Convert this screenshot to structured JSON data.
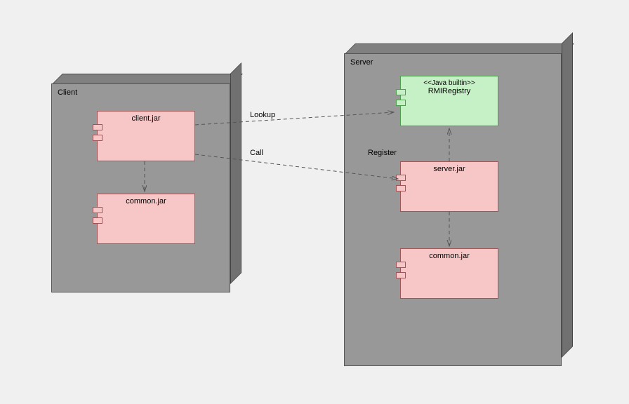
{
  "nodes": {
    "client": {
      "title": "Client"
    },
    "server": {
      "title": "Server"
    }
  },
  "components": {
    "client_jar": "client.jar",
    "client_common": "common.jar",
    "rmi_stereo": "<<Java builtin>>",
    "rmi_name": "RMIRegistry",
    "server_jar": "server.jar",
    "server_common": "common.jar"
  },
  "edges": {
    "lookup": "Lookup",
    "call": "Call",
    "register": "Register"
  }
}
